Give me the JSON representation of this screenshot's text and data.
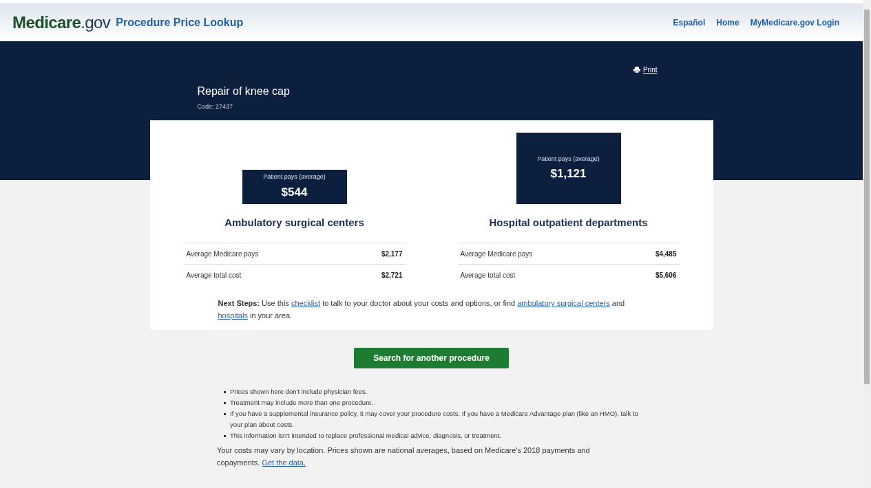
{
  "header": {
    "logo": {
      "brand": "Medicare",
      "tld": ".gov"
    },
    "app_title": "Procedure Price Lookup",
    "nav": [
      "Español",
      "Home",
      "MyMedicare.gov Login"
    ]
  },
  "procedure": {
    "print": "Print",
    "title": "Repair of knee cap",
    "code": "Code: 27437"
  },
  "settings": [
    {
      "name": "Ambulatory surgical centers",
      "patient_pays_label": "Patient pays (average)",
      "patient_pays": "$544",
      "highlighted": false,
      "rows": [
        {
          "label": "Average Medicare pays",
          "value": "$2,177"
        },
        {
          "label": "Average total cost",
          "value": "$2,721"
        }
      ]
    },
    {
      "name": "Hospital outpatient departments",
      "patient_pays_label": "Patient pays (average)",
      "patient_pays": "$1,121",
      "highlighted": true,
      "rows": [
        {
          "label": "Average Medicare pays",
          "value": "$4,485"
        },
        {
          "label": "Average total cost",
          "value": "$5,606"
        }
      ]
    }
  ],
  "next_steps": [
    {
      "kind": "text",
      "text": "**Next Steps:** Use this "
    },
    {
      "kind": "link",
      "text": "checklist"
    },
    {
      "kind": "text",
      "text": " to talk to your doctor about your costs and options, or find "
    },
    {
      "kind": "link",
      "text": "ambulatory surgical centers"
    },
    {
      "kind": "text",
      "text": " and "
    },
    {
      "kind": "link",
      "text": "hospitals"
    },
    {
      "kind": "text",
      "text": " in your area."
    }
  ],
  "search_button": "Search for another procedure",
  "notes": [
    "Prices shown here don't include physician fees.",
    "Treatment may include more than one procedure.",
    "If you have a supplemental insurance policy, it may cover your procedure costs. If you have a Medicare Advantage plan (like an HMO), talk to your plan about costs.",
    "This information isn't intended to replace professional medical advice, diagnosis, or treatment."
  ],
  "footer": [
    {
      "kind": "text",
      "text": "Your costs may vary by location. Prices shown are national averages, based on Medicare's 2018 payments and copayments. "
    },
    {
      "kind": "link",
      "text": "Get the data."
    }
  ]
}
